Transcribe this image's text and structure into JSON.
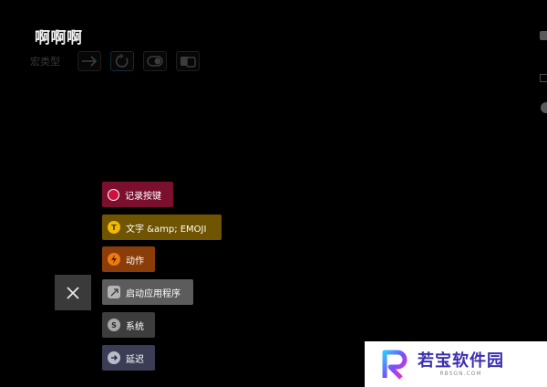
{
  "header": {
    "title": "啊啊啊",
    "macro_type_label": "宏类型",
    "macro_types": [
      {
        "icon": "arrow-right-icon",
        "active": false
      },
      {
        "icon": "rotate-icon",
        "active": true
      },
      {
        "icon": "toggle-icon",
        "active": false
      },
      {
        "icon": "multi-key-icon",
        "active": false
      }
    ]
  },
  "actions_menu": {
    "close_icon": "close-icon",
    "items": [
      {
        "label": "记录按键",
        "icon": "record-icon",
        "color": "#7a0f2e"
      },
      {
        "label": "文字 &amp; EMOJI",
        "icon": "text-icon",
        "icon_glyph": "T",
        "color": "#6f5402"
      },
      {
        "label": "动作",
        "icon": "lightning-icon",
        "color": "#8a3d08"
      },
      {
        "label": "启动应用程序",
        "icon": "launch-app-icon",
        "color": "#5c5c5c"
      },
      {
        "label": "系统",
        "icon": "system-icon",
        "icon_glyph": "S",
        "color": "#3d3d3d"
      },
      {
        "label": "延迟",
        "icon": "delay-icon",
        "color": "#3b3d55"
      }
    ]
  },
  "watermark": {
    "name": "若宝软件园",
    "url": "RBSGN.COM"
  }
}
